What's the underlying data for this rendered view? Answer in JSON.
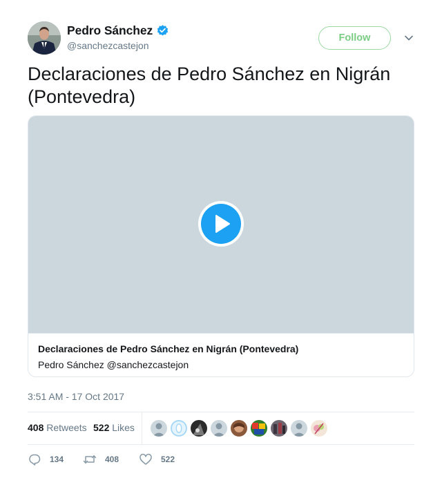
{
  "author": {
    "name": "Pedro Sánchez",
    "handle": "@sanchezcastejon"
  },
  "follow_label": "Follow",
  "tweet_text": "Declaraciones de Pedro Sánchez en Nigrán (Pontevedra)",
  "card": {
    "title": "Declaraciones de Pedro Sánchez en Nigrán (Pontevedra)",
    "subtitle": "Pedro Sánchez @sanchezcastejon"
  },
  "timestamp": "3:51 AM - 17 Oct 2017",
  "stats": {
    "retweets_count": "408",
    "retweets_label": "Retweets",
    "likes_count": "522",
    "likes_label": "Likes"
  },
  "actions": {
    "replies": "134",
    "retweets": "408",
    "likes": "522"
  },
  "colors": {
    "accent": "#1da1f2",
    "follow_green": "#7ccd84",
    "muted": "#657786",
    "video_bg": "#ccd6dd"
  }
}
